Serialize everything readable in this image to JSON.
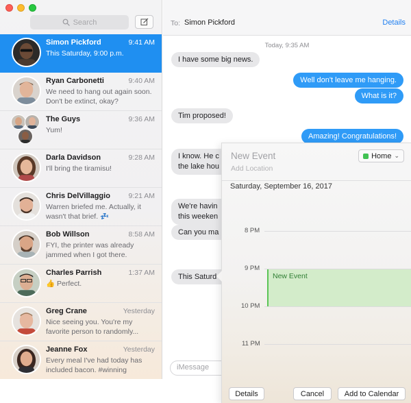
{
  "search": {
    "placeholder": "Search"
  },
  "conversations": [
    {
      "name": "Simon Pickford",
      "time": "9:41 AM",
      "preview": "This Saturday, 9:00 p.m.",
      "selected": true
    },
    {
      "name": "Ryan Carbonetti",
      "time": "9:40 AM",
      "preview": "We need to hang out again soon. Don't be extinct, okay?"
    },
    {
      "name": "The Guys",
      "time": "9:36 AM",
      "preview": "Yum!"
    },
    {
      "name": "Darla Davidson",
      "time": "9:28 AM",
      "preview": "I'll bring the tiramisu!"
    },
    {
      "name": "Chris DelVillaggio",
      "time": "9:21 AM",
      "preview": "Warren briefed me. Actually, it wasn't that brief. 💤"
    },
    {
      "name": "Bob Willson",
      "time": "8:58 AM",
      "preview": "FYI, the printer was already jammed when I got there."
    },
    {
      "name": "Charles Parrish",
      "time": "1:37 AM",
      "preview": "👍 Perfect."
    },
    {
      "name": "Greg Crane",
      "time": "Yesterday",
      "preview": "Nice seeing you. You're my favorite person to randomly..."
    },
    {
      "name": "Jeanne Fox",
      "time": "Yesterday",
      "preview": "Every meal I've had today has included bacon. #winning"
    }
  ],
  "chat": {
    "to_label": "To:",
    "to_name": "Simon Pickford",
    "details": "Details",
    "timestamp": "Today, 9:35 AM",
    "messages": [
      {
        "dir": "in",
        "text": "I have some big news."
      },
      {
        "dir": "out",
        "text": "Well don't leave me hanging."
      },
      {
        "dir": "out",
        "text": "What is it?"
      },
      {
        "dir": "in",
        "text": "Tim proposed!"
      },
      {
        "dir": "out",
        "text": "Amazing! Congratulations!"
      },
      {
        "dir": "in",
        "text": "I know. He c"
      },
      {
        "dir": "in",
        "text": "the lake hou"
      },
      {
        "dir": "in",
        "text": "We're havin"
      },
      {
        "dir": "in",
        "text": "this weeken"
      },
      {
        "dir": "in",
        "text": "Can you ma"
      },
      {
        "dir": "in",
        "text": "This Saturd"
      }
    ],
    "input_placeholder": "iMessage"
  },
  "event_popover": {
    "title_placeholder": "New Event",
    "location_placeholder": "Add Location",
    "calendar": "Home",
    "calendar_color": "#41c253",
    "date": "Saturday, September 16, 2017",
    "hours": [
      "8 PM",
      "9 PM",
      "10 PM",
      "11 PM"
    ],
    "event_label": "New Event",
    "buttons": {
      "details": "Details",
      "cancel": "Cancel",
      "add": "Add to Calendar"
    }
  },
  "colors": {
    "accent": "#1f8ff1",
    "bubble_out": "#2f9bf7",
    "bubble_in": "#e7e7e9",
    "event_fill": "#d3ecca"
  }
}
